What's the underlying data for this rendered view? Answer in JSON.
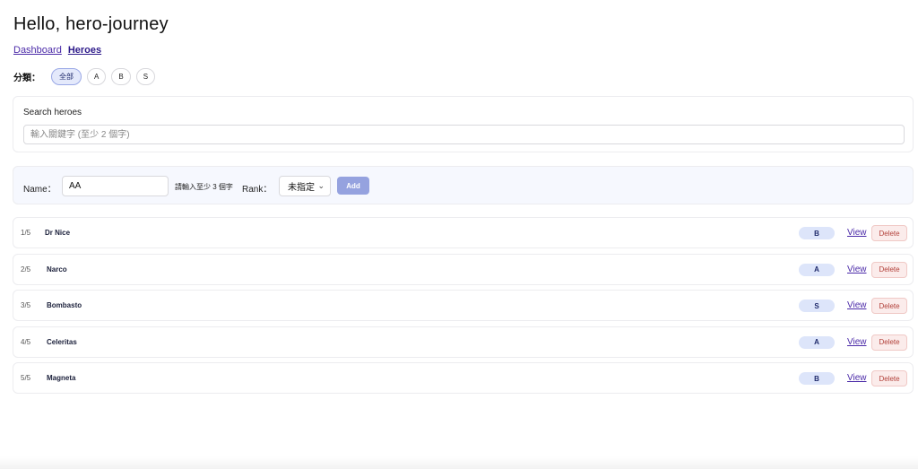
{
  "header": {
    "title": "Hello, hero-journey"
  },
  "nav": {
    "dashboard": "Dashboard",
    "heroes": "Heroes"
  },
  "filter": {
    "label": "分類：",
    "chips": [
      "全部",
      "A",
      "B",
      "S"
    ],
    "selected": "全部"
  },
  "search": {
    "label": "Search heroes",
    "placeholder": "輸入關鍵字 (至少 2 個字)",
    "value": ""
  },
  "add_form": {
    "name_label": "Name：",
    "name_value": "AA",
    "hint": "請輸入至少 3 個字",
    "rank_label": "Rank：",
    "rank_value": "未指定",
    "add_label": "Add"
  },
  "heroes": [
    {
      "index": "1/5",
      "name": "Dr Nice",
      "rank": "B"
    },
    {
      "index": "2/5",
      "name": "Narco",
      "rank": "A"
    },
    {
      "index": "3/5",
      "name": "Bombasto",
      "rank": "S"
    },
    {
      "index": "4/5",
      "name": "Celeritas",
      "rank": "A"
    },
    {
      "index": "5/5",
      "name": "Magneta",
      "rank": "B"
    }
  ],
  "row_actions": {
    "view": "View",
    "delete": "Delete"
  },
  "colors": {
    "accent": "#95a2df",
    "link": "#4b2aa8",
    "badge_bg": "#dde5fa",
    "delete_bg": "#fbeceb",
    "delete_text": "#b2403a"
  }
}
